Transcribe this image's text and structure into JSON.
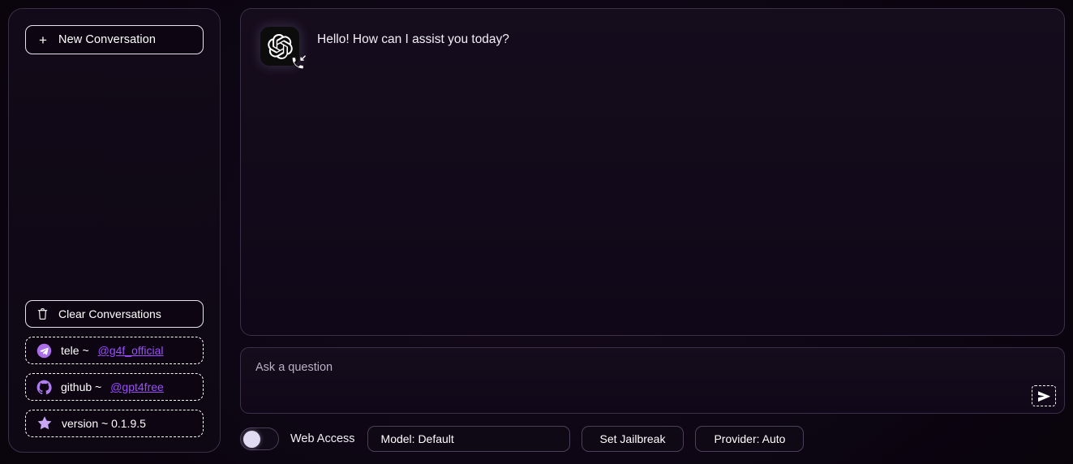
{
  "sidebar": {
    "new_conversation": {
      "label": "New Conversation",
      "icon": "plus-icon"
    },
    "clear_conversations": {
      "label": "Clear Conversations",
      "icon": "trash-icon"
    },
    "links": [
      {
        "icon": "telegram-icon",
        "prefix": "tele ~ ",
        "link_text": "@g4f_official"
      },
      {
        "icon": "github-icon",
        "prefix": "github ~ ",
        "link_text": "@gpt4free"
      }
    ],
    "version": {
      "icon": "star-icon",
      "label": "version ~ 0.1.9.5"
    }
  },
  "chat": {
    "messages": [
      {
        "avatar_icon": "openai-logo-icon",
        "badge_icon": "incoming-call-icon",
        "text": "Hello! How can I assist you today?"
      }
    ]
  },
  "composer": {
    "placeholder": "Ask a question",
    "value": "",
    "send_icon": "send-plane-icon"
  },
  "controls": {
    "web_access": {
      "label": "Web Access",
      "enabled": false
    },
    "model_button": "Model: Default",
    "jailbreak_button": "Set Jailbreak",
    "provider_button": "Provider: Auto"
  },
  "colors": {
    "accent_link": "#9b4dff",
    "accent_icon": "#b07cf0",
    "page_bg": "#0c0512",
    "panel_bg": "#140a18",
    "panel_border": "#3a3048",
    "text": "#ffffff"
  }
}
